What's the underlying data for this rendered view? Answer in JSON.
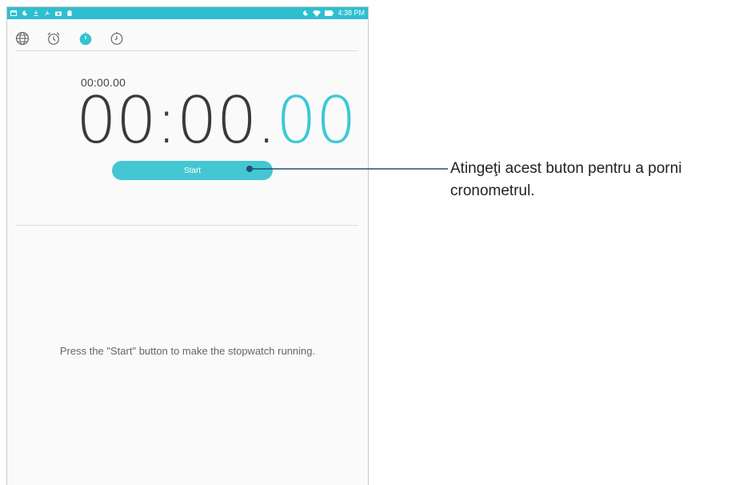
{
  "status_bar": {
    "time": "4:38 PM",
    "left_icons": [
      "calendar-icon",
      "moon-icon",
      "download-icon",
      "wrench-icon",
      "camera-icon",
      "clipboard-icon"
    ],
    "right_icons": [
      "moon-icon",
      "wifi-icon",
      "battery-icon"
    ]
  },
  "tabs": [
    {
      "icon": "globe-icon",
      "active": false
    },
    {
      "icon": "alarm-clock-icon",
      "active": false
    },
    {
      "icon": "stopwatch-icon",
      "active": true
    },
    {
      "icon": "timer-icon",
      "active": false
    }
  ],
  "stopwatch": {
    "lap_time": "00:00.00",
    "main_time": "00:00.",
    "centiseconds": "00",
    "start_label": "Start",
    "hint": "Press the \"Start\" button to make the stopwatch running."
  },
  "callout": {
    "text": "Atingeţi acest buton pentru a porni cronometrul."
  },
  "colors": {
    "accent": "#2ebfcf",
    "button": "#44c7d2",
    "callout_line": "#1f4f7a"
  }
}
